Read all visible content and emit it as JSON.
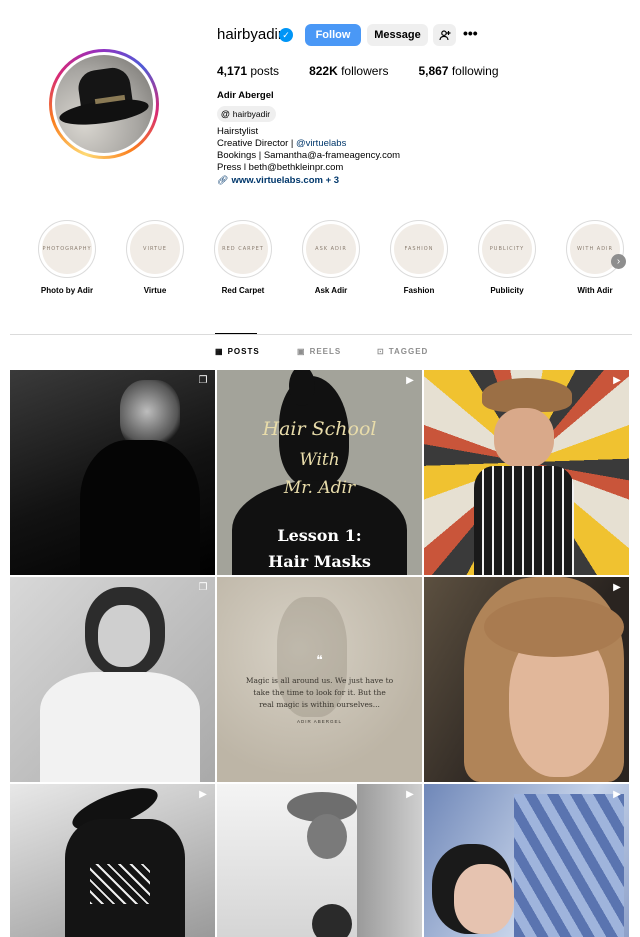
{
  "profile": {
    "username": "hairbyadir",
    "follow_label": "Follow",
    "message_label": "Message",
    "add_user_icon": "+",
    "more_icon": "•••",
    "stats": {
      "posts_count": "4,171",
      "posts_label": "posts",
      "followers_count": "822K",
      "followers_label": "followers",
      "following_count": "5,867",
      "following_label": "following"
    },
    "full_name": "Adir Abergel",
    "threads_handle": "hairbyadir",
    "bio": {
      "line1": "Hairstylist",
      "line2_prefix": "Creative Director | ",
      "line2_mention": "@virtuelabs",
      "line3": "Bookings | Samantha@a-frameagency.com",
      "line4": "Press l beth@bethkleinpr.com",
      "website": "www.virtuelabs.com + 3"
    }
  },
  "highlights": [
    {
      "cover": "PHOTOGRAPHY",
      "label": "Photo by Adir"
    },
    {
      "cover": "VIRTUE",
      "label": "Virtue"
    },
    {
      "cover": "RED CARPET",
      "label": "Red Carpet"
    },
    {
      "cover": "ASK ADIR",
      "label": "Ask Adir"
    },
    {
      "cover": "FASHION",
      "label": "Fashion"
    },
    {
      "cover": "PUBLICITY",
      "label": "Publicity"
    },
    {
      "cover": "WITH ADIR",
      "label": "With Adir"
    }
  ],
  "tabs": {
    "posts": "POSTS",
    "reels": "REELS",
    "tagged": "TAGGED"
  },
  "posts": {
    "tile2_line1": "Hair School",
    "tile2_line2": "With",
    "tile2_line3": "Mr. Adir",
    "tile2_lesson": "Lesson 1:",
    "tile2_topic": "Hair Masks",
    "tile5_quote": "Magic is all around us. We just have to take the time to look for it. But the real magic is within ourselves...",
    "tile5_sign": "ADIR ABERGEL"
  },
  "colors": {
    "follow_button": "#4a98f6",
    "link": "#00376b",
    "verified": "#0095f6"
  }
}
